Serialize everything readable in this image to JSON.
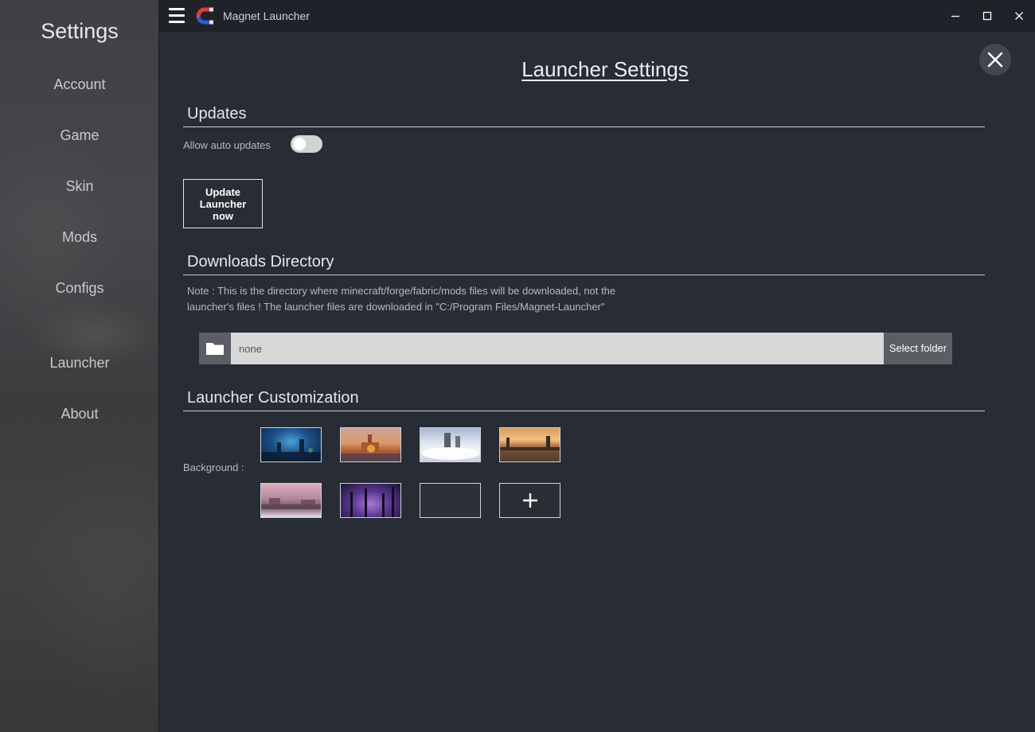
{
  "window": {
    "app_title": "Magnet Launcher",
    "icons": [
      "hamburger-menu-icon",
      "magnet-logo-icon",
      "minimize-icon",
      "maximize-icon",
      "close-icon"
    ]
  },
  "sidebar": {
    "title": "Settings",
    "items": [
      {
        "label": "Account"
      },
      {
        "label": "Game"
      },
      {
        "label": "Skin"
      },
      {
        "label": "Mods"
      },
      {
        "label": "Configs"
      },
      {
        "label": "Launcher"
      },
      {
        "label": "About"
      }
    ]
  },
  "main": {
    "title": "Launcher Settings",
    "updates": {
      "heading": "Updates",
      "auto_updates_label": "Allow auto updates",
      "auto_updates_enabled": false,
      "update_button_label": "Update Launcher now"
    },
    "downloads": {
      "heading": "Downloads Directory",
      "note": "Note : This is the directory where minecraft/forge/fabric/mods files will be downloaded, not the launcher's files ! The launcher files are downloaded in \"C:/Program Files/Magnet-Launcher\"",
      "folder_value": "none",
      "select_folder_label": "Select folder"
    },
    "customization": {
      "heading": "Launcher Customization",
      "background_label": "Background :",
      "add_icon": "plus-icon"
    }
  },
  "colors": {
    "background": "#282c35",
    "titlebar": "#1f2229",
    "sidebar": "#404142",
    "input_bg": "#d8d8d8",
    "button_gray": "#5b5e63"
  }
}
